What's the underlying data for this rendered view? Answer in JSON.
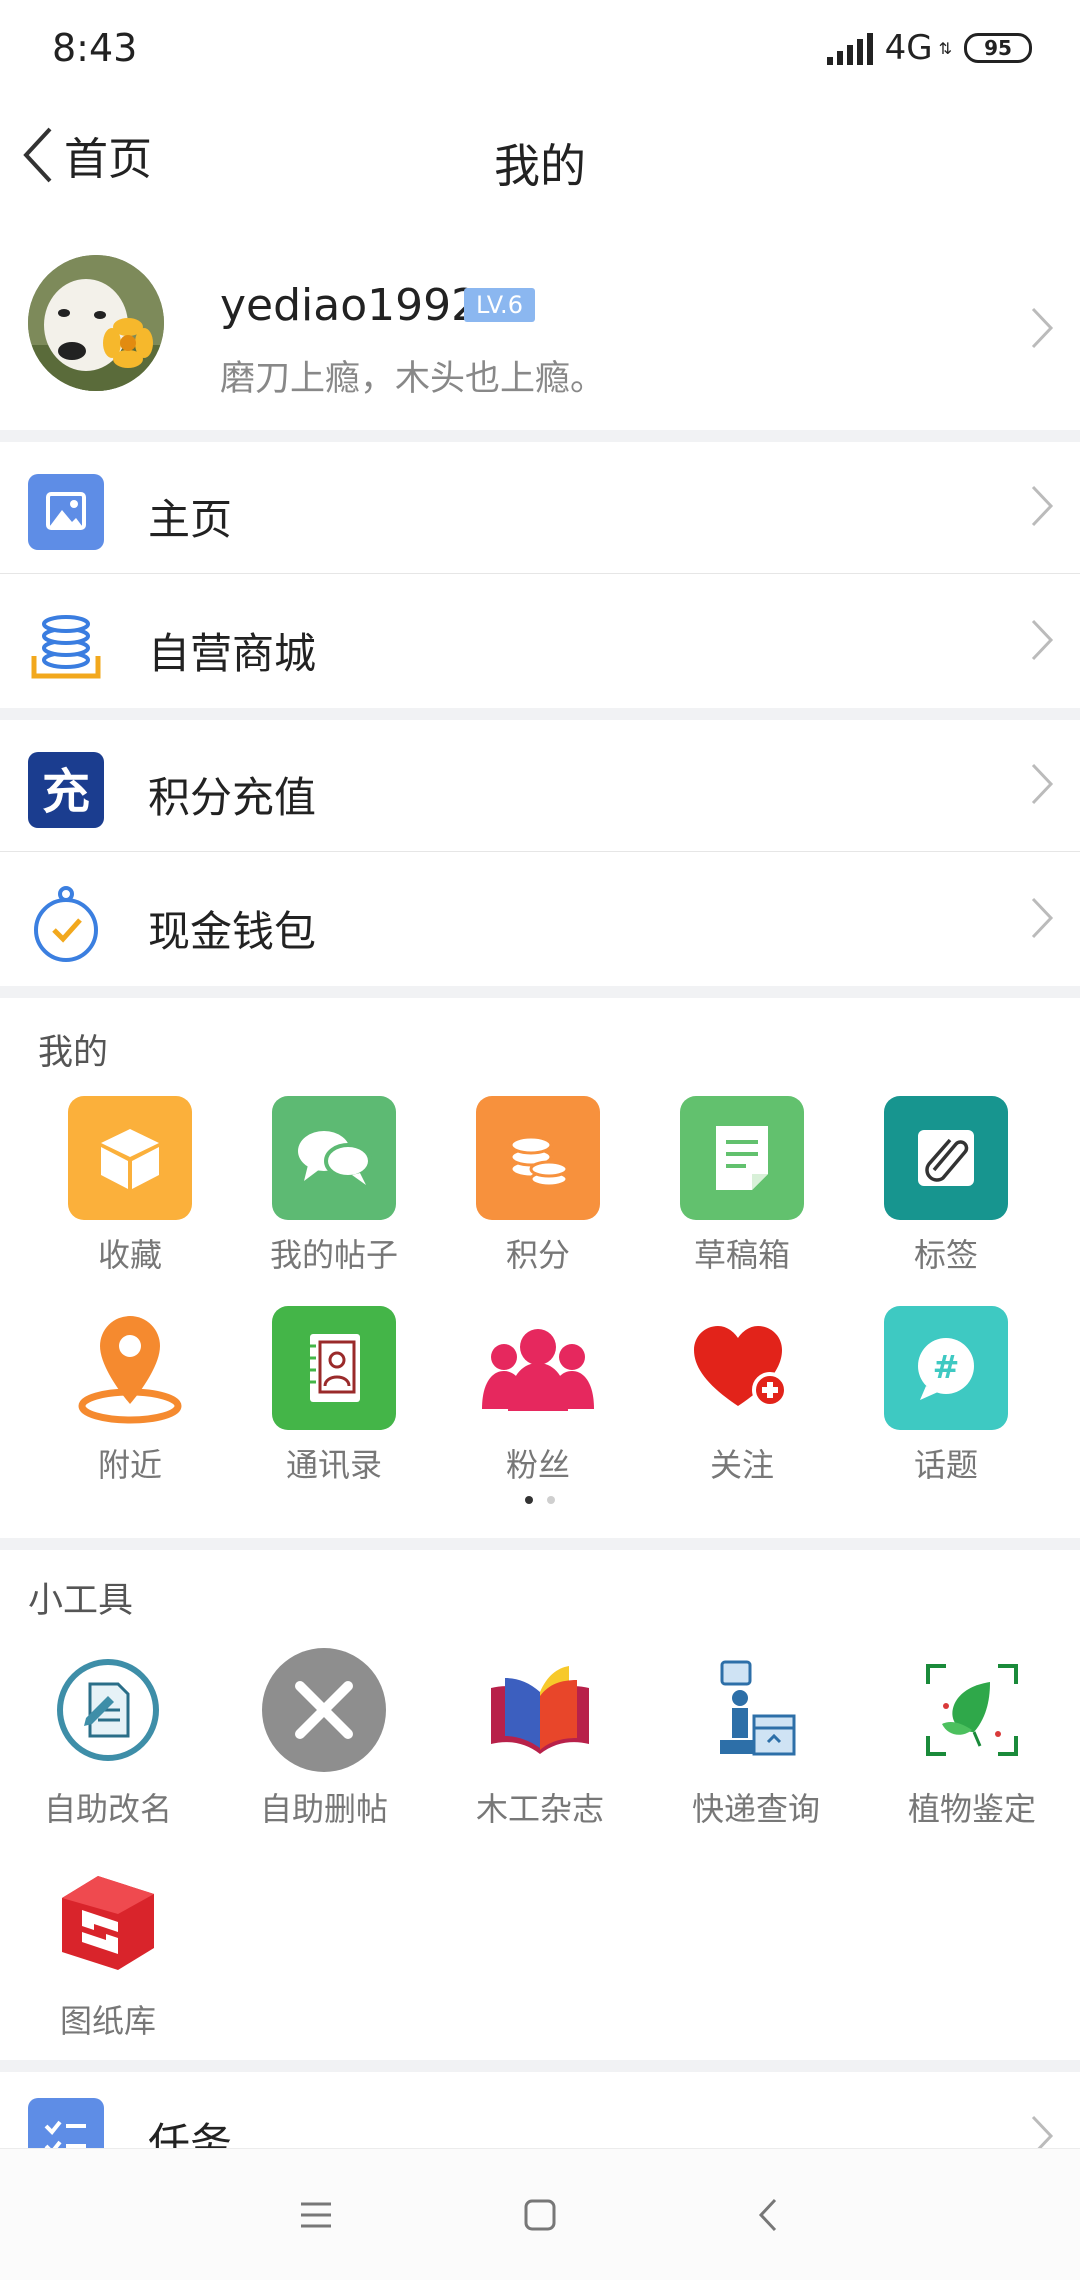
{
  "status_bar": {
    "time": "8:43",
    "network": "4G",
    "battery": "95"
  },
  "nav": {
    "back_label": "首页",
    "title": "我的"
  },
  "profile": {
    "username": "yediao1992",
    "level": "LV.6",
    "signature": "磨刀上瘾，木头也上瘾。"
  },
  "menu": [
    {
      "label": "主页",
      "icon": "image-icon"
    },
    {
      "label": "自营商城",
      "icon": "coin-stack-icon"
    },
    {
      "label": "积分充值",
      "icon": "recharge-icon"
    },
    {
      "label": "现金钱包",
      "icon": "wallet-check-icon"
    }
  ],
  "my_section": {
    "title": "我的",
    "items": [
      {
        "label": "收藏",
        "icon": "box-icon",
        "color": "#fbb03b"
      },
      {
        "label": "我的帖子",
        "icon": "chat-bubbles-icon",
        "color": "#5dba73"
      },
      {
        "label": "积分",
        "icon": "coins-icon",
        "color": "#f7913d"
      },
      {
        "label": "草稿箱",
        "icon": "document-icon",
        "color": "#62c16e"
      },
      {
        "label": "标签",
        "icon": "paperclip-icon",
        "color": "#17958f"
      },
      {
        "label": "附近",
        "icon": "location-pin-icon",
        "color": "#f58a2f"
      },
      {
        "label": "通讯录",
        "icon": "contacts-book-icon",
        "color": "#44b548"
      },
      {
        "label": "粉丝",
        "icon": "fans-icon",
        "color": "#e6285e"
      },
      {
        "label": "关注",
        "icon": "heart-plus-icon",
        "color": "#e2231a"
      },
      {
        "label": "话题",
        "icon": "hashtag-bubble-icon",
        "color": "#3ec9c2"
      }
    ],
    "page_indicator": {
      "current": 1,
      "total": 2
    }
  },
  "tools_section": {
    "title": "小工具",
    "items": [
      {
        "label": "自助改名",
        "icon": "rename-icon"
      },
      {
        "label": "自助删帖",
        "icon": "delete-post-icon"
      },
      {
        "label": "木工杂志",
        "icon": "magazine-book-icon"
      },
      {
        "label": "快递查询",
        "icon": "delivery-icon"
      },
      {
        "label": "植物鉴定",
        "icon": "plant-scan-icon"
      },
      {
        "label": "图纸库",
        "icon": "sketchup-icon"
      }
    ]
  },
  "task_row": {
    "label": "任务",
    "icon": "task-list-icon"
  }
}
